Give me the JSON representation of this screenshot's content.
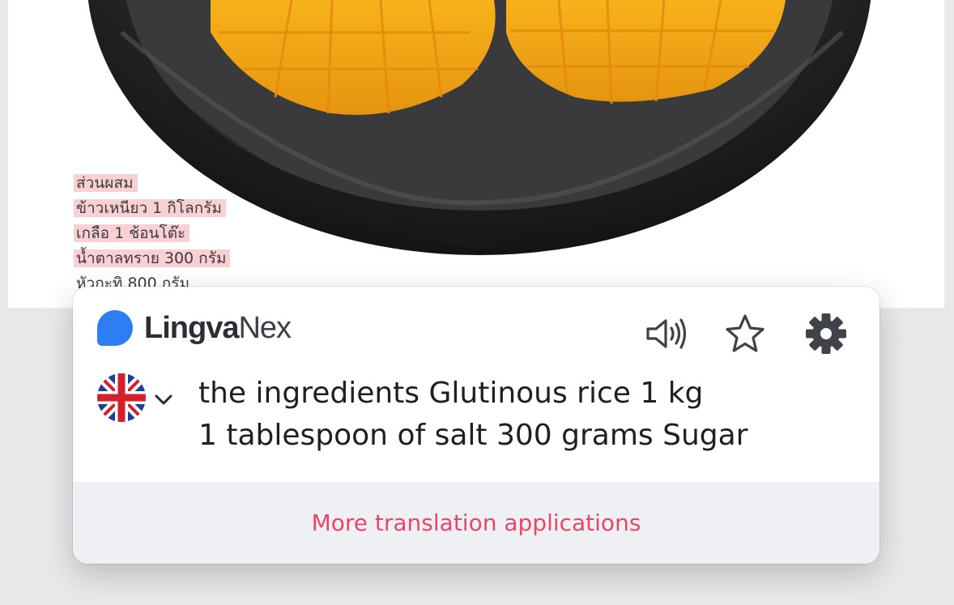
{
  "page": {
    "thai_lines": [
      "ส่วนผสม",
      "ข้าวเหนียว 1 กิโลกรัม",
      "เกลือ 1 ช้อนโต๊ะ",
      "น้ำตาลทราย 300 กรัม",
      "หัวกะทิ 800 กรัม"
    ]
  },
  "popup": {
    "brand_bold": "Lingva",
    "brand_light": "Nex",
    "translation_line1": "the ingredients Glutinous rice 1 kg",
    "translation_line2": "1 tablespoon of salt 300 grams Sugar",
    "footer_link": "More translation applications",
    "icons": {
      "speaker": "speaker-icon",
      "favorite": "star-icon",
      "settings": "gear-icon",
      "language": "uk-flag-icon",
      "dropdown": "chevron-down-icon"
    },
    "colors": {
      "brand_blue": "#2f7df3",
      "link_pink": "#e8476a",
      "highlight": "#f9d0d3",
      "footer_bg": "#eef0f3"
    }
  }
}
